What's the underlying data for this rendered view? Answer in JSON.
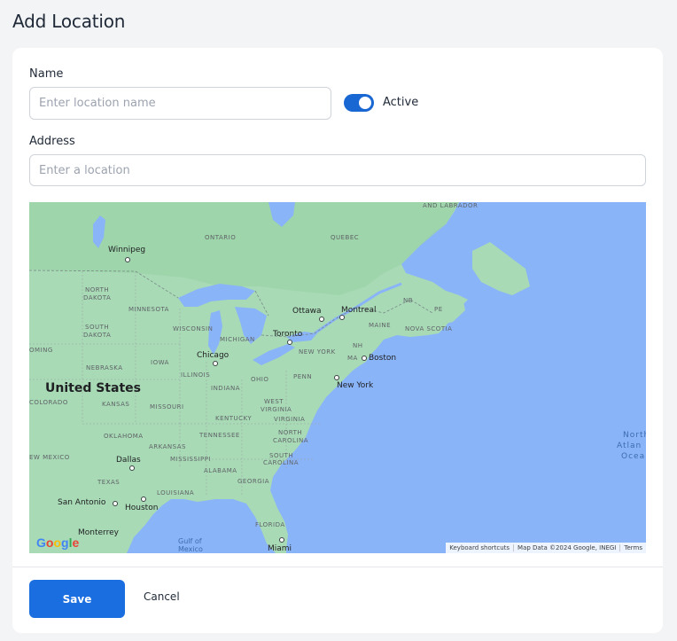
{
  "page": {
    "title": "Add Location"
  },
  "form": {
    "name_label": "Name",
    "name_placeholder": "Enter location name",
    "name_value": "",
    "active_label": "Active",
    "active": true,
    "address_label": "Address",
    "address_placeholder": "Enter a location",
    "address_value": ""
  },
  "map": {
    "country": "United States",
    "regions": {
      "labrador": "AND LABRADOR",
      "ontario": "ONTARIO",
      "quebec": "QUEBEC",
      "north_dakota_1": "NORTH",
      "north_dakota_2": "DAKOTA",
      "minnesota": "MINNESOTA",
      "nb": "NB",
      "pe": "PE",
      "south_dakota_1": "SOUTH",
      "south_dakota_2": "DAKOTA",
      "wisconsin": "WISCONSIN",
      "maine": "MAINE",
      "nova_scotia": "NOVA SCOTIA",
      "michigan": "MICHIGAN",
      "nh": "NH",
      "oming": "OMING",
      "nebraska": "NEBRASKA",
      "iowa": "IOWA",
      "new_york": "NEW YORK",
      "ma": "MA",
      "illinois": "ILLINOIS",
      "penn": "PENN",
      "ohio": "OHIO",
      "indiana": "INDIANA",
      "colorado": "COLORADO",
      "kansas": "KANSAS",
      "missouri": "MISSOURI",
      "west_virginia_1": "WEST",
      "west_virginia_2": "VIRGINIA",
      "kentucky": "KENTUCKY",
      "virginia": "VIRGINIA",
      "oklahoma": "OKLAHOMA",
      "tennessee": "TENNESSEE",
      "north_carolina_1": "NORTH",
      "north_carolina_2": "CAROLINA",
      "arkansas": "ARKANSAS",
      "new_mexico": "EW MEXICO",
      "mississippi": "MISSISSIPPI",
      "south_carolina_1": "SOUTH",
      "south_carolina_2": "CAROLINA",
      "alabama": "ALABAMA",
      "georgia": "GEORGIA",
      "texas": "TEXAS",
      "louisiana": "LOUISIANA",
      "florida": "FLORIDA"
    },
    "cities": {
      "winnipeg": "Winnipeg",
      "ottawa": "Ottawa",
      "montreal": "Montreal",
      "toronto": "Toronto",
      "chicago": "Chicago",
      "boston": "Boston",
      "new_york": "New York",
      "dallas": "Dallas",
      "san_antonio": "San Antonio",
      "houston": "Houston",
      "monterrey": "Monterrey",
      "miami": "Miami"
    },
    "water": {
      "gulf_1": "Gulf of",
      "gulf_2": "Mexico",
      "atlantic_1": "North",
      "atlantic_2": "Atlan",
      "atlantic_3": "Ocea"
    },
    "logo": "Google",
    "attribution": {
      "shortcuts": "Keyboard shortcuts",
      "data": "Map Data ©2024 Google, INEGI",
      "terms": "Terms"
    },
    "colors": {
      "water": "#8ab4f8",
      "land": "#a8dab5",
      "land_north": "#9bd3a8"
    }
  },
  "actions": {
    "save_label": "Save",
    "cancel_label": "Cancel"
  },
  "colors": {
    "primary": "#1a6ee0",
    "toggle": "#1967d2"
  }
}
